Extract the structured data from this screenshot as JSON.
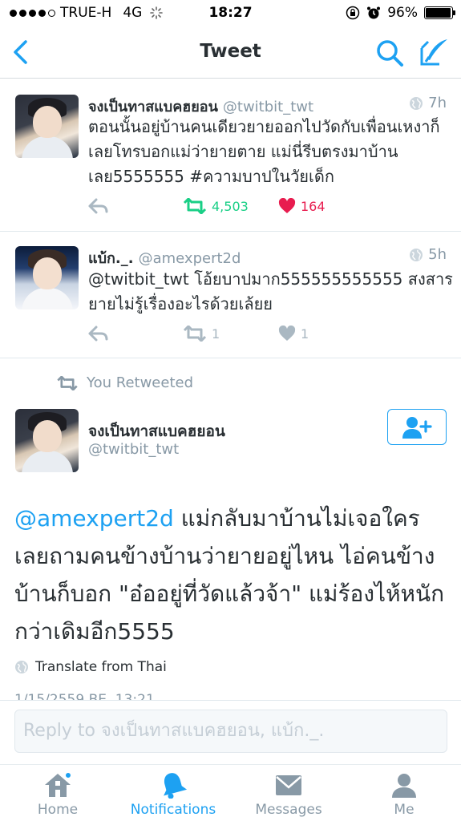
{
  "status_bar": {
    "carrier": "TRUE-H",
    "network": "4G",
    "time": "18:27",
    "battery_percent": "96%",
    "battery_level": 0.96
  },
  "nav": {
    "title": "Tweet",
    "accent_color": "#1da1f2"
  },
  "tweets": [
    {
      "name": "จงเป็นทาสแบคฮยอน",
      "handle": "@twitbit_twt",
      "time": "7h",
      "text": "ตอนนั้นอยู่บ้านคนเดียวยายออกไปวัดกับเพื่อนเหงาก็เลยโทรบอกแม่ว่ายายตาย แม่นี่รีบตรงมาบ้านเลย5555555 #ความบาปในวัยเด็ก",
      "retweets": "4,503",
      "likes": "164",
      "retweeted": true,
      "liked": true
    },
    {
      "name": "แบ้ก._.",
      "handle": "@amexpert2d",
      "time": "5h",
      "text": "@twitbit_twt โอ้ยบาปมาก555555555555 สงสารยายไม่รู้เรื่องอะไรด้วยเล้ยย",
      "retweets": "1",
      "likes": "1",
      "retweeted": false,
      "liked": false
    }
  ],
  "focused": {
    "retweet_banner": "You Retweeted",
    "name": "จงเป็นทาสแบคฮยอน",
    "handle": "@twitbit_twt",
    "mention": "@amexpert2d",
    "text": " แม่กลับมาบ้านไม่เจอใคร เลยถามคนข้างบ้านว่ายายอยู่ไหน ไอ่คนข้างบ้านก็บอก \"อ๋ออยู่ที่วัดแล้วจ้า\" แม่ร้องไห้หนักกว่าเดิมอีก5555",
    "translate": "Translate from Thai",
    "date": "1/15/2559 BE, 13:21"
  },
  "reply": {
    "placeholder": "Reply to จงเป็นทาสแบคฮยอน, แบ้ก._."
  },
  "tabs": [
    {
      "label": "Home",
      "icon": "home-icon",
      "active": false,
      "has_badge": true
    },
    {
      "label": "Notifications",
      "icon": "bell-icon",
      "active": true,
      "has_badge": false
    },
    {
      "label": "Messages",
      "icon": "envelope-icon",
      "active": false,
      "has_badge": false
    },
    {
      "label": "Me",
      "icon": "person-icon",
      "active": false,
      "has_badge": false
    }
  ]
}
